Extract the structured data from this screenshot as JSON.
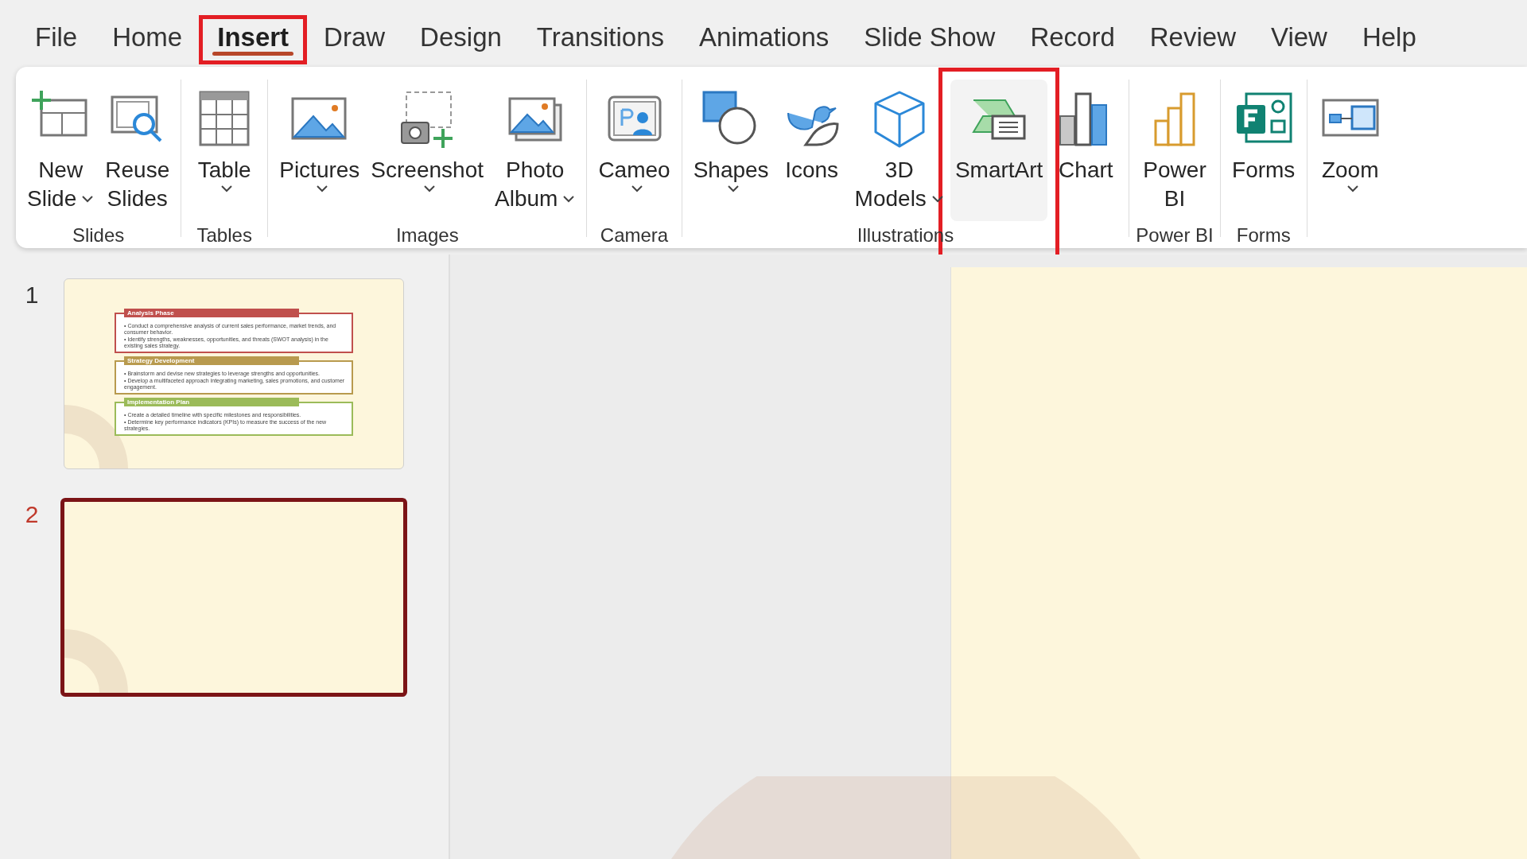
{
  "tabs": [
    {
      "label": "File",
      "selected": false,
      "highlighted": false
    },
    {
      "label": "Home",
      "selected": false,
      "highlighted": false
    },
    {
      "label": "Insert",
      "selected": true,
      "highlighted": true
    },
    {
      "label": "Draw",
      "selected": false,
      "highlighted": false
    },
    {
      "label": "Design",
      "selected": false,
      "highlighted": false
    },
    {
      "label": "Transitions",
      "selected": false,
      "highlighted": false
    },
    {
      "label": "Animations",
      "selected": false,
      "highlighted": false
    },
    {
      "label": "Slide Show",
      "selected": false,
      "highlighted": false
    },
    {
      "label": "Record",
      "selected": false,
      "highlighted": false
    },
    {
      "label": "Review",
      "selected": false,
      "highlighted": false
    },
    {
      "label": "View",
      "selected": false,
      "highlighted": false
    },
    {
      "label": "Help",
      "selected": false,
      "highlighted": false
    }
  ],
  "ribbon": {
    "groups": [
      {
        "label": "Slides",
        "buttons": [
          {
            "lines": [
              "New",
              "Slide"
            ],
            "kind": "inline-caret",
            "selected": false,
            "highlighted": false
          },
          {
            "lines": [
              "Reuse",
              "Slides"
            ],
            "kind": "plain",
            "selected": false,
            "highlighted": false
          }
        ]
      },
      {
        "label": "Tables",
        "buttons": [
          {
            "lines": [
              "Table"
            ],
            "kind": "caret-below",
            "selected": false,
            "highlighted": false
          }
        ]
      },
      {
        "label": "Images",
        "buttons": [
          {
            "lines": [
              "Pictures"
            ],
            "kind": "caret-below",
            "selected": false,
            "highlighted": false
          },
          {
            "lines": [
              "Screenshot"
            ],
            "kind": "caret-below",
            "selected": false,
            "highlighted": false
          },
          {
            "lines": [
              "Photo",
              "Album"
            ],
            "kind": "inline-caret",
            "selected": false,
            "highlighted": false
          }
        ]
      },
      {
        "label": "Camera",
        "buttons": [
          {
            "lines": [
              "Cameo"
            ],
            "kind": "caret-below",
            "selected": false,
            "highlighted": false
          }
        ]
      },
      {
        "label": "Illustrations",
        "buttons": [
          {
            "lines": [
              "Shapes"
            ],
            "kind": "caret-below",
            "selected": false,
            "highlighted": false
          },
          {
            "lines": [
              "Icons"
            ],
            "kind": "plain",
            "selected": false,
            "highlighted": false
          },
          {
            "lines": [
              "3D",
              "Models"
            ],
            "kind": "inline-caret",
            "selected": false,
            "highlighted": false
          },
          {
            "lines": [
              "SmartArt"
            ],
            "kind": "plain",
            "selected": true,
            "highlighted": true
          },
          {
            "lines": [
              "Chart"
            ],
            "kind": "plain",
            "selected": false,
            "highlighted": false
          }
        ]
      },
      {
        "label": "Power BI",
        "buttons": [
          {
            "lines": [
              "Power",
              "BI"
            ],
            "kind": "plain",
            "selected": false,
            "highlighted": false
          }
        ]
      },
      {
        "label": "Forms",
        "buttons": [
          {
            "lines": [
              "Forms"
            ],
            "kind": "plain",
            "selected": false,
            "highlighted": false
          }
        ]
      },
      {
        "buttons": [
          {
            "lines": [
              "Zoom"
            ],
            "kind": "caret-below",
            "selected": false,
            "highlighted": false
          }
        ]
      }
    ]
  },
  "slides": [
    {
      "number": "1",
      "selected": false,
      "sections": [
        {
          "title": "Analysis Phase",
          "color": "#c0504d",
          "bullets": [
            "• Conduct a comprehensive analysis of current sales performance, market trends, and consumer behavior.",
            "• Identify strengths, weaknesses, opportunities, and threats (SWOT analysis) in the existing sales strategy."
          ]
        },
        {
          "title": "Strategy Development",
          "color": "#b89a4e",
          "bullets": [
            "• Brainstorm and devise new strategies to leverage strengths and opportunities.",
            "• Develop a multifaceted approach integrating marketing, sales promotions, and customer engagement."
          ]
        },
        {
          "title": "Implementation Plan",
          "color": "#9bbb59",
          "bullets": [
            "• Create a detailed timeline with specific milestones and responsibilities.",
            "• Determine key performance indicators (KPIs) to measure the success of the new strategies."
          ]
        }
      ]
    },
    {
      "number": "2",
      "selected": true
    }
  ]
}
